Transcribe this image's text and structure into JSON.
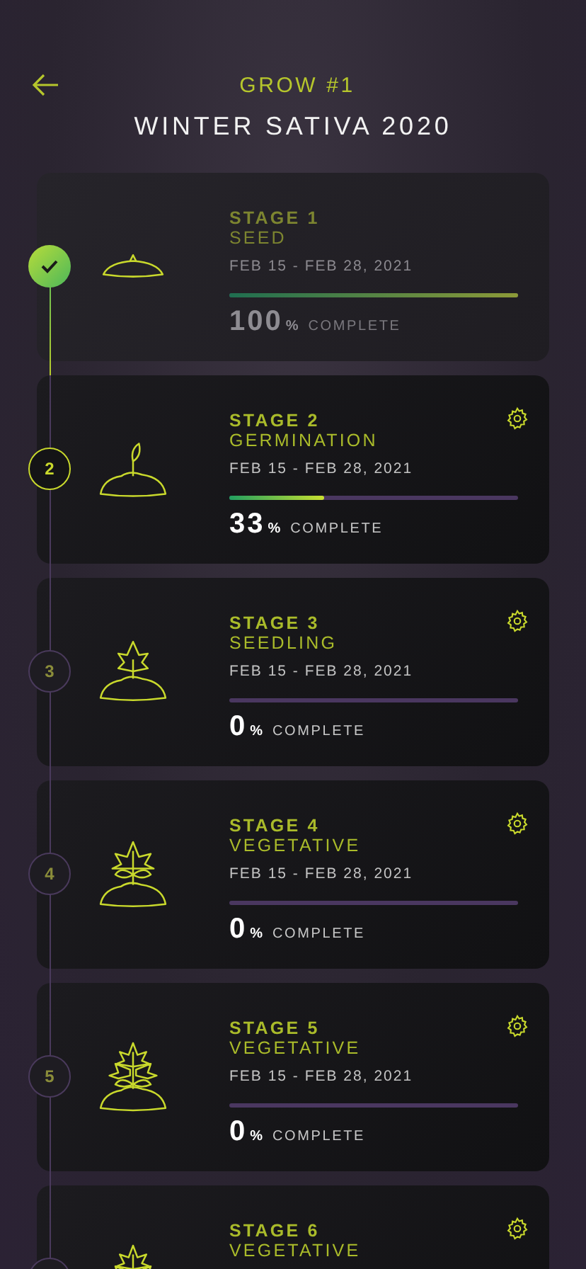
{
  "header": {
    "title": "GROW #1",
    "subtitle": "WINTER SATIVA 2020"
  },
  "stages": [
    {
      "kind": "seed",
      "completed": true,
      "current": false,
      "label": "STAGE 1",
      "name": "SEED",
      "dates": "FEB 15 - FEB 28, 2021",
      "level": 1,
      "percent": "100",
      "unit": "%",
      "caption": "COMPLETE",
      "settings": false
    },
    {
      "kind": "sprout",
      "completed": false,
      "current": true,
      "step": "2",
      "label": "STAGE 2",
      "name": "GERMINATION",
      "dates": "FEB 15 - FEB 28, 2021",
      "level": 0.33,
      "percent": "33",
      "unit": "%",
      "caption": "COMPLETE",
      "settings": true
    },
    {
      "kind": "seedling",
      "completed": false,
      "current": false,
      "step": "3",
      "label": "STAGE 3",
      "name": "SEEDLING",
      "dates": "FEB 15 - FEB 28, 2021",
      "level": 0,
      "percent": "0",
      "unit": "%",
      "caption": "COMPLETE",
      "settings": true
    },
    {
      "kind": "plant",
      "completed": false,
      "current": false,
      "step": "4",
      "label": "STAGE 4",
      "name": "VEGETATIVE",
      "dates": "FEB 15 - FEB 28, 2021",
      "level": 0,
      "percent": "0",
      "unit": "%",
      "caption": "COMPLETE",
      "settings": true
    },
    {
      "kind": "bush",
      "completed": false,
      "current": false,
      "step": "5",
      "label": "STAGE 5",
      "name": "VEGETATIVE",
      "dates": "FEB 15 - FEB 28, 2021",
      "level": 0,
      "percent": "0",
      "unit": "%",
      "caption": "COMPLETE",
      "settings": true
    },
    {
      "kind": "bush",
      "completed": false,
      "current": false,
      "label": "STAGE 6",
      "name": "VEGETATIVE",
      "settings": true
    }
  ]
}
